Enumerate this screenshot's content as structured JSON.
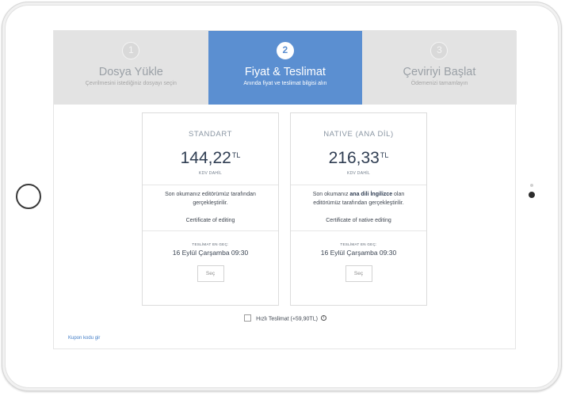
{
  "steps": [
    {
      "num": "1",
      "title": "Dosya Yükle",
      "subtitle": "Çevrilmesini istediğiniz dosyayı seçin",
      "active": false
    },
    {
      "num": "2",
      "title": "Fiyat & Teslimat",
      "subtitle": "Anında fiyat ve teslimat bilgisi alın",
      "active": true
    },
    {
      "num": "3",
      "title": "Çeviriyi Başlat",
      "subtitle": "Ödemenizi tamamlayın",
      "active": false
    }
  ],
  "plans": [
    {
      "label": "STANDART",
      "price": "144,22",
      "currency": "TL",
      "tax_note": "KDV DAHİL",
      "desc_a": "Son okumanız editörümüz tarafından gerçekleştirilir.",
      "desc_b": "",
      "desc_c": "",
      "cert": "Certificate of editing",
      "delivery_label": "TESLİMAT EN GEÇ:",
      "delivery_date": "16 Eylül Çarşamba 09:30",
      "select_label": "Seç"
    },
    {
      "label": "NATIVE (ANA DİL)",
      "price": "216,33",
      "currency": "TL",
      "tax_note": "KDV DAHİL",
      "desc_a": "Son okumanız ",
      "desc_b": "ana dili İngilizce",
      "desc_c": " olan editörümüz tarafından gerçekleştirilir.",
      "cert": "Certificate of native editing",
      "delivery_label": "TESLİMAT EN GEÇ:",
      "delivery_date": "16 Eylül Çarşamba 09:30",
      "select_label": "Seç"
    }
  ],
  "rush": {
    "label": "Hızlı Teslimat (+59,90TL)",
    "info_glyph": "i",
    "checked": false
  },
  "coupon": {
    "label": "Kupon kodu gir"
  },
  "colors": {
    "accent": "#5b8fd1",
    "inactive_step": "#e3e3e3",
    "link": "#3f7bc6"
  }
}
